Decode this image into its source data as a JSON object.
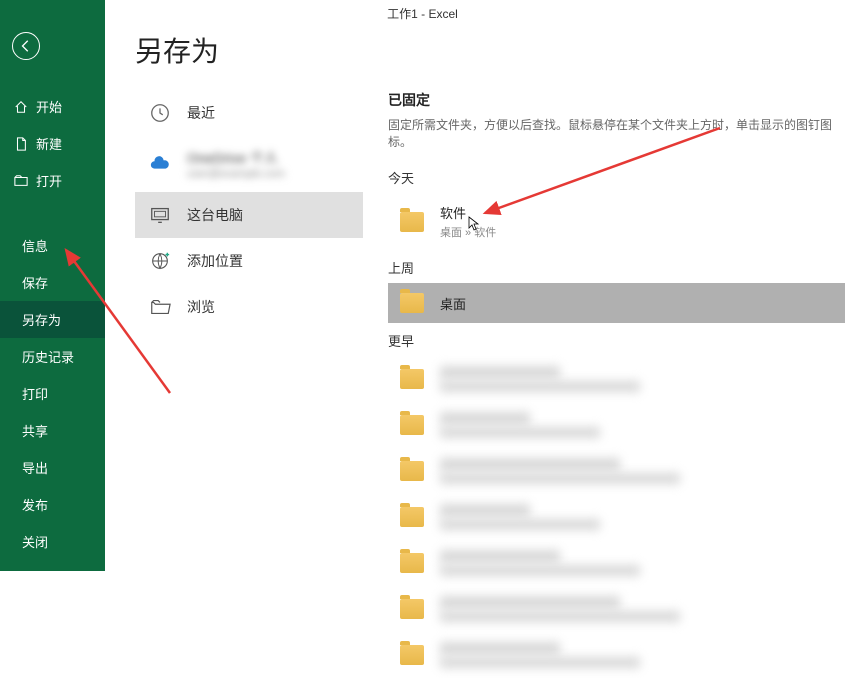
{
  "app_title": "工作1  -  Excel",
  "page_title": "另存为",
  "sidebar": {
    "items": [
      {
        "label": "开始",
        "icon": "home"
      },
      {
        "label": "新建",
        "icon": "new"
      },
      {
        "label": "打开",
        "icon": "open"
      }
    ],
    "sub_items": [
      {
        "label": "信息"
      },
      {
        "label": "保存"
      },
      {
        "label": "另存为",
        "active": true
      },
      {
        "label": "历史记录"
      },
      {
        "label": "打印"
      },
      {
        "label": "共享"
      },
      {
        "label": "导出"
      },
      {
        "label": "发布"
      },
      {
        "label": "关闭"
      }
    ]
  },
  "locations": {
    "recent": "最近",
    "account_line1": "OneDrive 个人",
    "account_line2": "user@example.com",
    "this_pc": "这台电脑",
    "add_place": "添加位置",
    "browse": "浏览"
  },
  "pinned": {
    "title": "已固定",
    "description": "固定所需文件夹，方便以后查找。鼠标悬停在某个文件夹上方时，单击显示的图钉图标。"
  },
  "sections": {
    "today": "今天",
    "last_week": "上周",
    "earlier": "更早"
  },
  "folders": {
    "today": [
      {
        "name": "软件",
        "path": "桌面 » 软件"
      }
    ],
    "last_week": [
      {
        "name": "桌面",
        "path": "",
        "highlighted": true
      }
    ],
    "earlier_count": 7
  },
  "colors": {
    "brand": "#0d6b3f",
    "annotation": "#e53935"
  }
}
